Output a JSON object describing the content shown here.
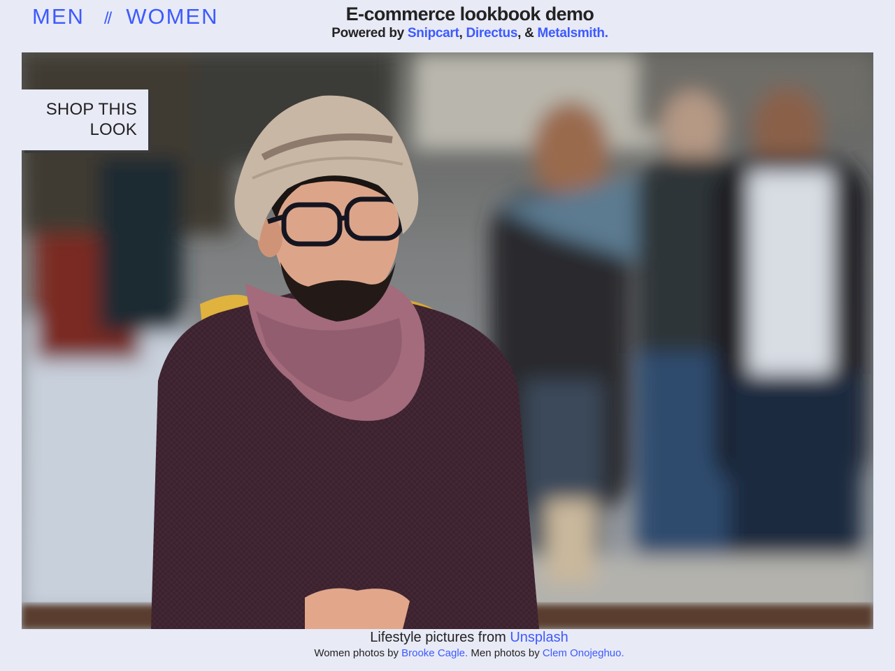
{
  "nav": {
    "men_label": "MEN",
    "separator": "//",
    "women_label": "WOMEN"
  },
  "header": {
    "title": "E-commerce lookbook demo",
    "powered_prefix": "Powered by ",
    "snipcart": "Snipcart",
    "comma": ",",
    "directus": "Directus",
    "amp": ", & ",
    "metalsmith": "Metalsmith."
  },
  "hero": {
    "shop_label": "SHOP THIS LOOK"
  },
  "footer": {
    "lifestyle_prefix": "Lifestyle pictures from ",
    "unsplash": "Unsplash",
    "women_prefix": "Women photos by ",
    "women_credit": "Brooke Cagle.",
    "men_prefix": " Men photos by ",
    "men_credit": "Clem Onojeghuo."
  },
  "colors": {
    "page_background": "#e8eaf6",
    "accent": "#3d5afe",
    "text": "#222222"
  }
}
